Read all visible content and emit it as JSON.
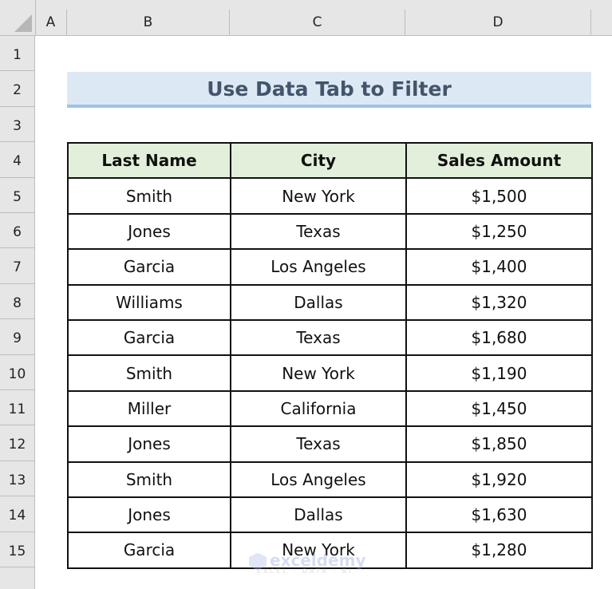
{
  "spreadsheet": {
    "columns": [
      "A",
      "B",
      "C",
      "D"
    ],
    "rows": [
      "1",
      "2",
      "3",
      "4",
      "5",
      "6",
      "7",
      "8",
      "9",
      "10",
      "11",
      "12",
      "13",
      "14",
      "15"
    ],
    "title": "Use Data Tab to Filter",
    "table": {
      "headers": [
        "Last Name",
        "City",
        "Sales Amount"
      ],
      "rows": [
        [
          "Smith",
          "New York",
          "$1,500"
        ],
        [
          "Jones",
          "Texas",
          "$1,250"
        ],
        [
          "Garcia",
          "Los Angeles",
          "$1,400"
        ],
        [
          "Williams",
          "Dallas",
          "$1,320"
        ],
        [
          "Garcia",
          "Texas",
          "$1,680"
        ],
        [
          "Smith",
          "New York",
          "$1,190"
        ],
        [
          "Miller",
          "California",
          "$1,450"
        ],
        [
          "Jones",
          "Texas",
          "$1,850"
        ],
        [
          "Smith",
          "Los Angeles",
          "$1,920"
        ],
        [
          "Jones",
          "Dallas",
          "$1,630"
        ],
        [
          "Garcia",
          "New York",
          "$1,280"
        ]
      ]
    }
  },
  "watermark": {
    "name": "exceldemy",
    "tagline": "EXCEL - DATA - BI"
  },
  "colors": {
    "title_bg": "#dce9f5",
    "title_text": "#44546a",
    "header_bg": "#e2efda"
  }
}
